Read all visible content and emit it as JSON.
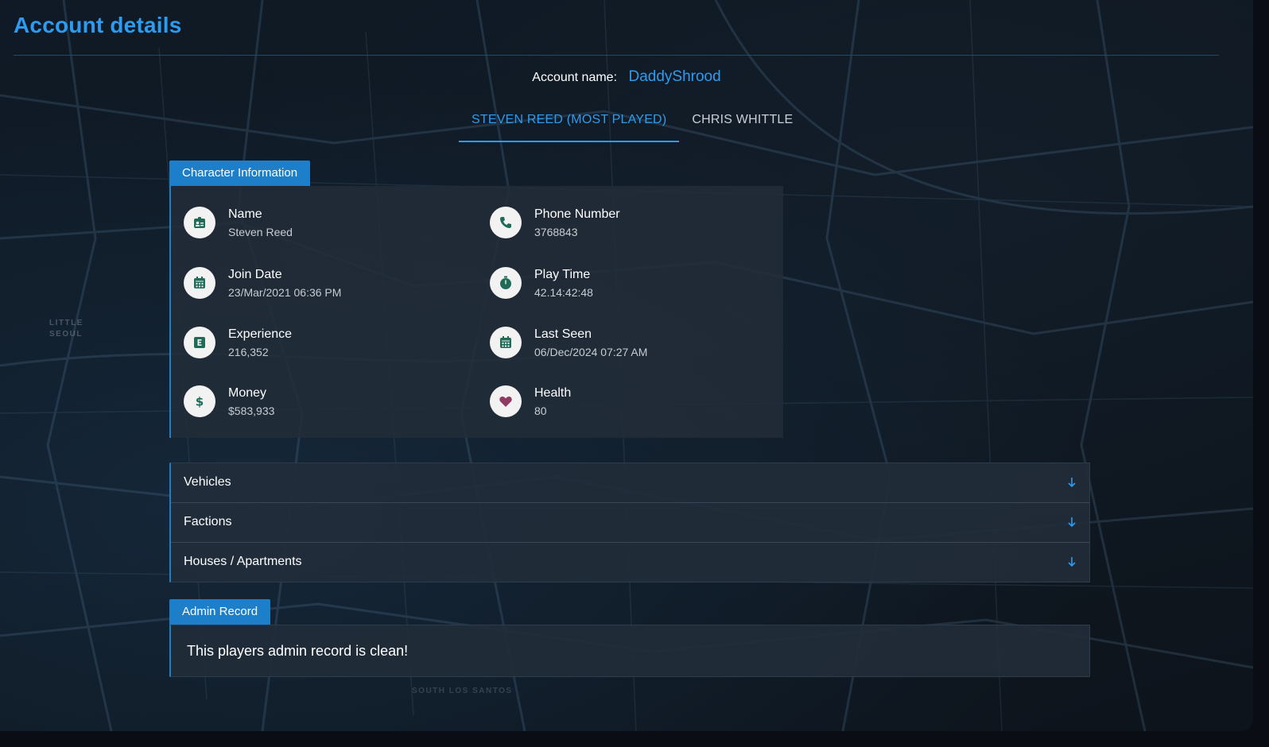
{
  "header": {
    "title": "Account details"
  },
  "map": {
    "district_label_1": "LITTLE",
    "district_label_2": "SEOUL",
    "bottom_label": "SOUTH LOS SANTOS"
  },
  "account": {
    "label": "Account name:",
    "name": "DaddyShrood"
  },
  "tabs": [
    {
      "label": "STEVEN REED (MOST PLAYED)",
      "active": true
    },
    {
      "label": "CHRIS WHITTLE",
      "active": false
    }
  ],
  "character": {
    "section_label": "Character Information",
    "fields": [
      {
        "label": "Name",
        "value": "Steven Reed",
        "icon": "id-badge-icon"
      },
      {
        "label": "Phone Number",
        "value": "3768843",
        "icon": "phone-icon"
      },
      {
        "label": "Join Date",
        "value": "23/Mar/2021 06:36 PM",
        "icon": "calendar-icon"
      },
      {
        "label": "Play Time",
        "value": "42.14:42:48",
        "icon": "stopwatch-icon"
      },
      {
        "label": "Experience",
        "value": "216,352",
        "icon": "experience-icon"
      },
      {
        "label": "Last Seen",
        "value": "06/Dec/2024 07:27 AM",
        "icon": "calendar-icon"
      },
      {
        "label": "Money",
        "value": "$583,933",
        "icon": "dollar-icon"
      },
      {
        "label": "Health",
        "value": "80",
        "icon": "heart-icon"
      }
    ]
  },
  "accordion": [
    {
      "label": "Vehicles"
    },
    {
      "label": "Factions"
    },
    {
      "label": "Houses / Apartments"
    }
  ],
  "admin": {
    "section_label": "Admin Record",
    "message": "This players admin record is clean!"
  },
  "colors": {
    "accent": "#2d9cf0",
    "tab_bg": "#1d7fca",
    "icon_green": "#1e6b57",
    "heart": "#8e3a63"
  }
}
